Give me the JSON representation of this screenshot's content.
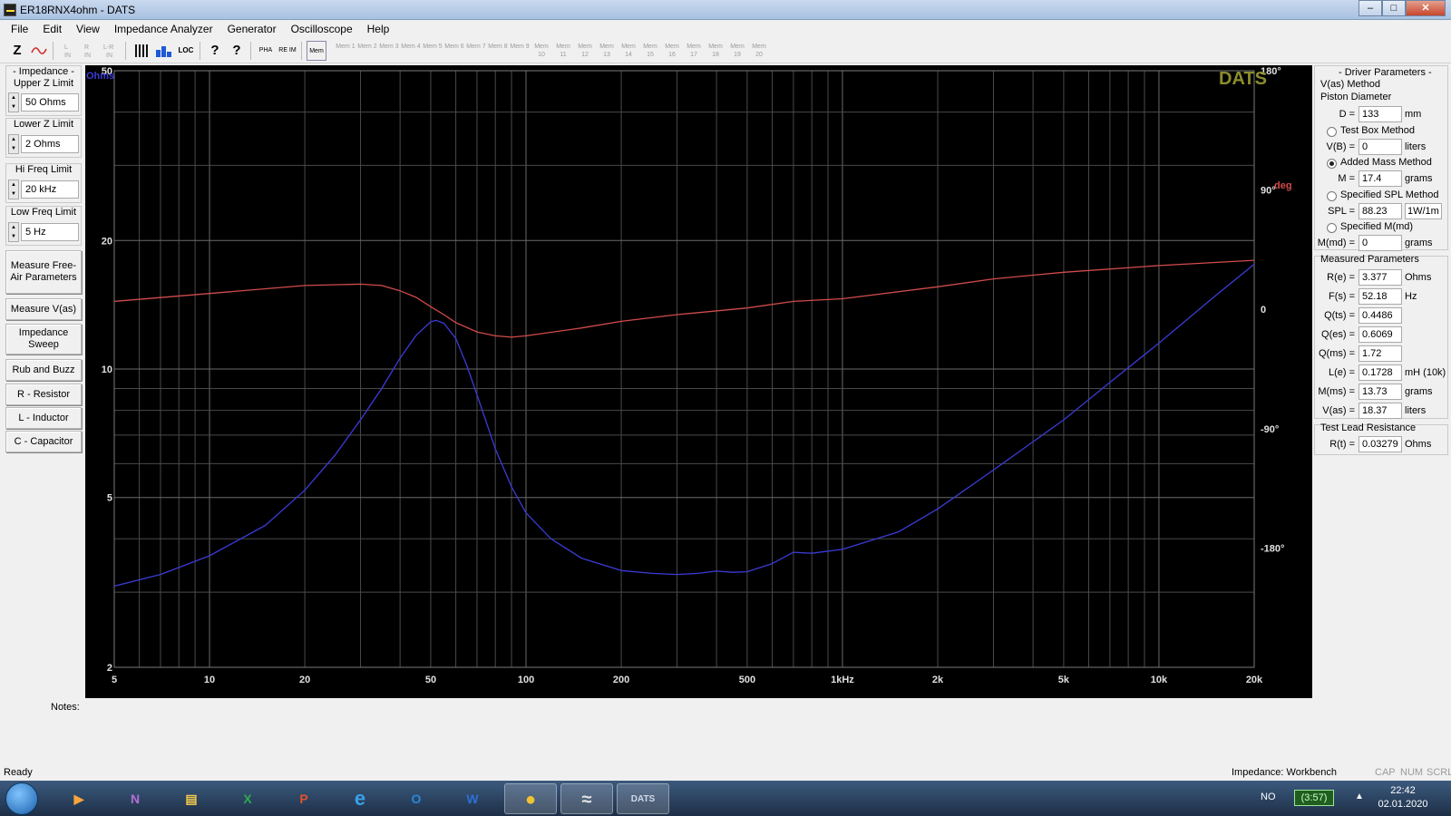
{
  "window": {
    "title": "ER18RNX4ohm - DATS",
    "min": "–",
    "max": "□",
    "close": "✕"
  },
  "menu": [
    "File",
    "Edit",
    "View",
    "Impedance Analyzer",
    "Generator",
    "Oscilloscope",
    "Help"
  ],
  "toolbar": {
    "z_label": "Z",
    "loc_label": "LOC",
    "help_label": "?",
    "help_cursor_label": "?",
    "pha_label": "PHA",
    "re_im_label": "RE IM",
    "mem_active_label": "Mem",
    "mem_slots": [
      "Mem 1",
      "Mem 2",
      "Mem 3",
      "Mem 4",
      "Mem 5",
      "Mem 6",
      "Mem 7",
      "Mem 8",
      "Mem 9",
      "Mem 10",
      "Mem 11",
      "Mem 12",
      "Mem 13",
      "Mem 14",
      "Mem 15",
      "Mem 16",
      "Mem 17",
      "Mem 18",
      "Mem 19",
      "Mem 20"
    ]
  },
  "left": {
    "impedance_group": "- Impedance -",
    "upper_z_label": "Upper Z Limit",
    "upper_z_value": "50 Ohms",
    "lower_z_label": "Lower Z Limit",
    "lower_z_value": "2 Ohms",
    "hi_freq_label": "Hi Freq Limit",
    "hi_freq_value": "20 kHz",
    "low_freq_label": "Low Freq Limit",
    "low_freq_value": "5 Hz",
    "buttons": [
      "Measure Free-Air Parameters",
      "Measure V(as)",
      "Impedance Sweep",
      "Rub and Buzz",
      "R - Resistor",
      "L - Inductor",
      "C - Capacitor"
    ]
  },
  "plot": {
    "watermark": "DATS",
    "left_unit": "Ohms",
    "right_unit": "deg",
    "accent_impedance": "#3b3bd6",
    "accent_phase": "#d24b4b",
    "watermark_color": "#8c8c2c"
  },
  "chart_data": {
    "type": "line",
    "title": "",
    "xlabel": "",
    "ylabel": "Ohms",
    "y2label": "deg",
    "xscale": "log",
    "yscale": "log",
    "xlim": [
      5,
      20000
    ],
    "ylim": [
      2,
      50
    ],
    "y2lim": [
      -270,
      180
    ],
    "x_ticks": [
      "5",
      "10",
      "20",
      "50",
      "100",
      "200",
      "500",
      "1kHz",
      "2k",
      "5k",
      "10k",
      "20k"
    ],
    "x_tick_values": [
      5,
      10,
      20,
      50,
      100,
      200,
      500,
      1000,
      2000,
      5000,
      10000,
      20000
    ],
    "y_ticks": [
      "50",
      "20",
      "10",
      "5",
      "2"
    ],
    "y_tick_values": [
      50,
      20,
      10,
      5,
      2
    ],
    "y2_ticks": [
      "180°",
      "90°",
      "0",
      "-90°",
      "-180°"
    ],
    "y2_tick_values": [
      180,
      90,
      0,
      -90,
      -180
    ],
    "grid": true,
    "series": [
      {
        "color": "#3b3bd6",
        "axis": "left",
        "x": [
          5,
          7,
          10,
          15,
          20,
          25,
          30,
          35,
          40,
          45,
          50,
          52,
          55,
          60,
          65,
          70,
          80,
          90,
          100,
          120,
          150,
          200,
          250,
          300,
          350,
          400,
          450,
          500,
          600,
          700,
          800,
          1000,
          1500,
          2000,
          3000,
          5000,
          7000,
          10000,
          15000,
          20000
        ],
        "y": [
          3.1,
          3.3,
          3.65,
          4.3,
          5.2,
          6.3,
          7.6,
          9.0,
          10.6,
          12.0,
          12.9,
          13.0,
          12.8,
          11.8,
          10.2,
          8.7,
          6.5,
          5.3,
          4.6,
          4.0,
          3.6,
          3.37,
          3.32,
          3.3,
          3.32,
          3.36,
          3.34,
          3.35,
          3.5,
          3.72,
          3.7,
          3.78,
          4.15,
          4.7,
          5.8,
          7.6,
          9.3,
          11.5,
          14.8,
          17.6
        ]
      },
      {
        "color": "#d24b4b",
        "axis": "right",
        "x": [
          5,
          10,
          20,
          30,
          35,
          40,
          45,
          50,
          55,
          60,
          70,
          80,
          90,
          100,
          150,
          200,
          300,
          500,
          700,
          1000,
          2000,
          3000,
          5000,
          10000,
          20000
        ],
        "y": [
          6,
          12,
          18,
          19,
          18,
          14,
          9,
          2,
          -4,
          -10,
          -17,
          -20,
          -21,
          -20,
          -14,
          -9,
          -4,
          1,
          6,
          8,
          17,
          23,
          28,
          33,
          37
        ]
      }
    ]
  },
  "right": {
    "driver_group": "- Driver Parameters -",
    "vas_method": "V(as) Method",
    "piston_diameter": "Piston Diameter",
    "d_label": "D =",
    "d_value": "133",
    "d_unit": "mm",
    "test_box": "Test Box Method",
    "vb_label": "V(B) =",
    "vb_value": "0",
    "vb_unit": "liters",
    "added_mass": "Added Mass Method",
    "m_label": "M =",
    "m_value": "17.4",
    "m_unit": "grams",
    "spl_method": "Specified SPL Method",
    "spl_label": "SPL =",
    "spl_value": "88.23",
    "spl_unit": "1W/1m",
    "mmd_method": "Specified M(md)",
    "mmd_label": "M(md) =",
    "mmd_value": "0",
    "mmd_unit": "grams",
    "measured_group": "Measured Parameters",
    "params": [
      {
        "label": "R(e) =",
        "value": "3.377",
        "unit": "Ohms"
      },
      {
        "label": "F(s) =",
        "value": "52.18",
        "unit": "Hz"
      },
      {
        "label": "Q(ts) =",
        "value": "0.4486",
        "unit": ""
      },
      {
        "label": "Q(es) =",
        "value": "0.6069",
        "unit": ""
      },
      {
        "label": "Q(ms) =",
        "value": "1.72",
        "unit": ""
      },
      {
        "label": "L(e) =",
        "value": "0.1728",
        "unit": "mH (10k)"
      },
      {
        "label": "M(ms) =",
        "value": "13.73",
        "unit": "grams"
      },
      {
        "label": "V(as) =",
        "value": "18.37",
        "unit": "liters"
      }
    ],
    "lead_group": "Test Lead Resistance",
    "rt_label": "R(t) =",
    "rt_value": "0.03279",
    "rt_unit": "Ohms"
  },
  "notes_label": "Notes:",
  "status": {
    "ready": "Ready",
    "mode": "Impedance: Workbench",
    "cap": "CAP",
    "num": "NUM",
    "scrl": "SCRL"
  },
  "taskbar": {
    "apps": [
      "▶",
      "N",
      "▤",
      "X",
      "P",
      "e",
      "O",
      "W",
      "●",
      "≈",
      "DATS"
    ],
    "lang": "NO",
    "battery": "(3:57)",
    "tray_arrow": "▲",
    "time": "22:42",
    "date": "02.01.2020"
  }
}
